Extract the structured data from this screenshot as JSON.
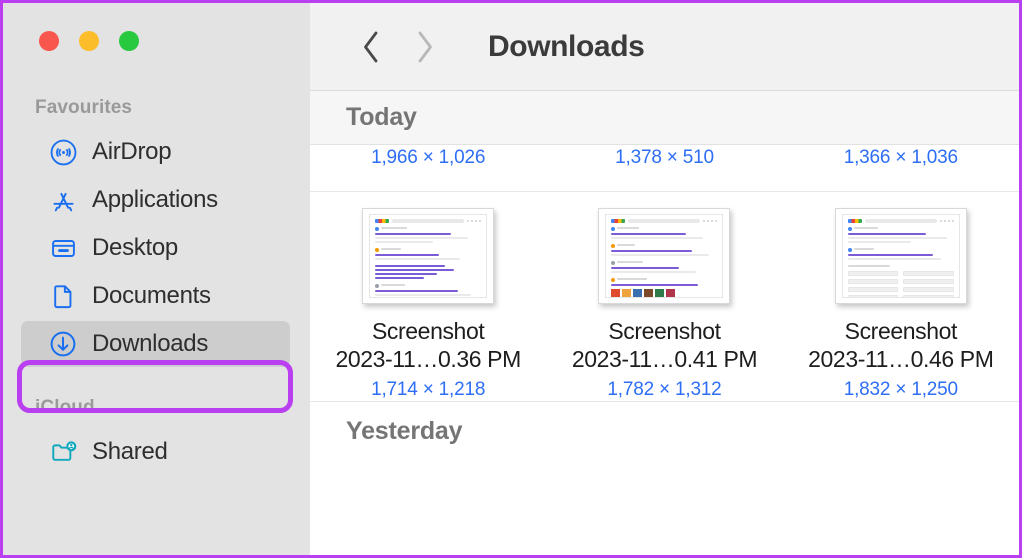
{
  "window": {
    "traffic_lights": [
      {
        "name": "close",
        "color": "#f9564d"
      },
      {
        "name": "minimize",
        "color": "#fcbd2a"
      },
      {
        "name": "maximize",
        "color": "#28c83f"
      }
    ],
    "annotation_color": "#b93ff0"
  },
  "sidebar": {
    "sections": [
      {
        "header": "Favourites",
        "items": [
          {
            "label": "AirDrop",
            "icon": "airdrop-icon",
            "selected": false
          },
          {
            "label": "Applications",
            "icon": "applications-icon",
            "selected": false
          },
          {
            "label": "Desktop",
            "icon": "desktop-icon",
            "selected": false
          },
          {
            "label": "Documents",
            "icon": "documents-icon",
            "selected": false
          },
          {
            "label": "Downloads",
            "icon": "downloads-icon",
            "selected": true
          }
        ]
      },
      {
        "header": "iCloud",
        "items": [
          {
            "label": "Shared",
            "icon": "shared-folder-icon",
            "selected": false
          }
        ]
      }
    ]
  },
  "toolbar": {
    "back_icon": "chevron-left-icon",
    "forward_icon": "chevron-right-icon",
    "title": "Downloads"
  },
  "main": {
    "groups": [
      {
        "label": "Today"
      },
      {
        "label": "Yesterday"
      }
    ],
    "clipped_row_dims": [
      "1,966 × 1,026",
      "1,378 × 510",
      "1,366 × 1,036"
    ],
    "files": [
      {
        "name_line1": "Screenshot",
        "name_line2": "2023-11…0.36 PM",
        "dimensions": "1,714 × 1,218",
        "thumbnail": "google-search-results"
      },
      {
        "name_line1": "Screenshot",
        "name_line2": "2023-11…0.41 PM",
        "dimensions": "1,782 × 1,312",
        "thumbnail": "google-search-results-with-images"
      },
      {
        "name_line1": "Screenshot",
        "name_line2": "2023-11…0.46 PM",
        "dimensions": "1,832 × 1,250",
        "thumbnail": "google-search-results-with-related"
      }
    ]
  },
  "colors": {
    "sidebar_bg": "#e3e3e3",
    "selected_row_bg": "#cdcdcd",
    "toolbar_bg": "#f1f1f1",
    "group_band_bg": "#f6f6f6",
    "link_blue": "#2d6ef5",
    "icon_blue": "#1a6ff0",
    "icon_teal": "#0fa8bd",
    "annotation_purple": "#b93ff0"
  }
}
